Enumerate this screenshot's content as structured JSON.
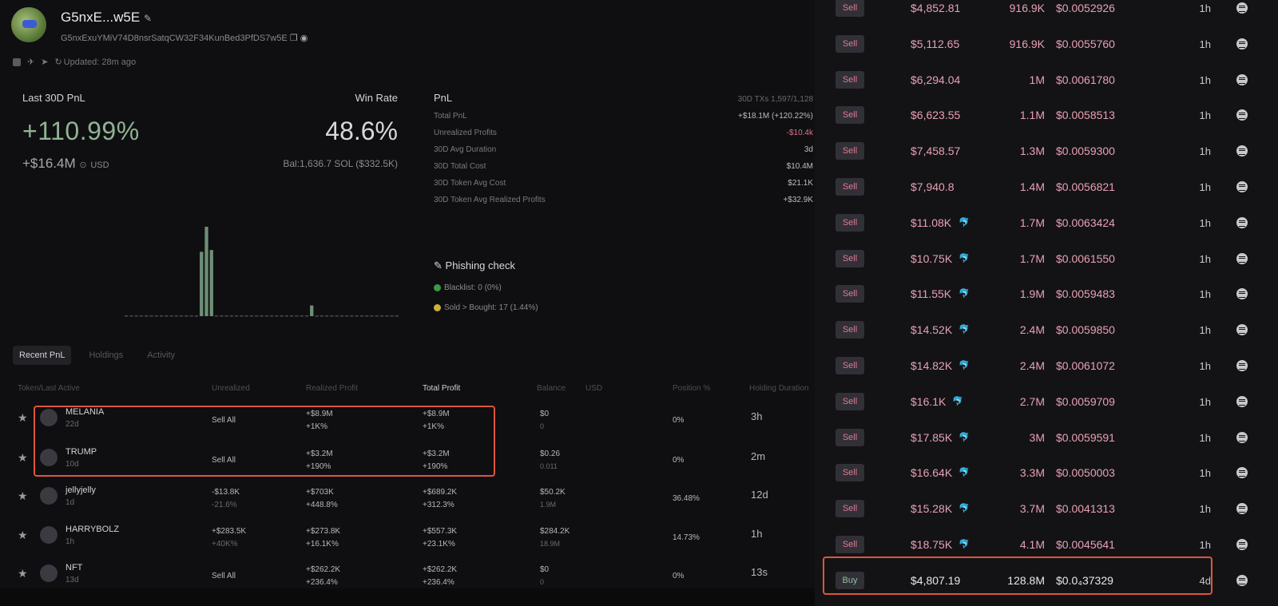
{
  "wallet": {
    "name": "G5nxE...w5E",
    "address": "G5nxExuYMiV74D8nsrSatqCW32F34KunBed3PfDS7w5E",
    "updated": "Updated: 28m ago"
  },
  "summary": {
    "pnl_label": "Last 30D PnL",
    "pnl_pct": "+110.99%",
    "pnl_usd": "+$16.4M",
    "usd_unit": "USD",
    "winrate_label": "Win Rate",
    "winrate": "48.6%",
    "balance": "Bal:1,636.7 SOL ($332.5K)"
  },
  "chart_data": {
    "type": "bar",
    "values": [
      0,
      0,
      0,
      0,
      0,
      0,
      0,
      0,
      0,
      0,
      0,
      0,
      0,
      0,
      0,
      72,
      100,
      74,
      0,
      0,
      0,
      0,
      0,
      0,
      0,
      0,
      0,
      0,
      0,
      0,
      0,
      0,
      0,
      0,
      0,
      0,
      0,
      12,
      0,
      0,
      0,
      0,
      0,
      0,
      0,
      0,
      0,
      0,
      0,
      0,
      0,
      0,
      0,
      0,
      0
    ]
  },
  "pnl": {
    "title": "PnL",
    "tx_label": "30D TXs",
    "tx_value": "1,597/1,128",
    "rows": [
      {
        "label": "Total PnL",
        "value": "+$18.1M (+120.22%)",
        "neg": false
      },
      {
        "label": "Unrealized Profits",
        "value": "-$10.4k",
        "neg": true
      },
      {
        "label": "30D Avg Duration",
        "value": "3d",
        "neg": false
      },
      {
        "label": "30D Total Cost",
        "value": "$10.4M",
        "neg": false
      },
      {
        "label": "30D Token Avg Cost",
        "value": "$21.1K",
        "neg": false
      },
      {
        "label": "30D Token Avg Realized Profits",
        "value": "+$32.9K",
        "neg": false
      }
    ]
  },
  "phishing": {
    "title": "Phishing check",
    "blacklist": "Blacklist: 0 (0%)",
    "sold_bought": "Sold > Bought: 17 (1.44%)"
  },
  "tabs": [
    "Recent PnL",
    "Holdings",
    "Activity"
  ],
  "table": {
    "headers": [
      "Token/Last Active",
      "Unrealized",
      "Realized Profit",
      "Total Profit",
      "Balance",
      "USD",
      "Position %",
      "Holding Duration"
    ],
    "rows": [
      {
        "name": "MELANIA",
        "age": "22d",
        "unreal1": "Sell All",
        "unreal2": "",
        "real1": "+$8.9M",
        "real2": "+1K%",
        "tot1": "+$8.9M",
        "tot2": "+1K%",
        "bal1": "$0",
        "bal2": "0",
        "pos": "0%",
        "hold": "3h"
      },
      {
        "name": "TRUMP",
        "age": "10d",
        "unreal1": "Sell All",
        "unreal2": "",
        "real1": "+$3.2M",
        "real2": "+190%",
        "tot1": "+$3.2M",
        "tot2": "+190%",
        "bal1": "$0.26",
        "bal2": "0.011",
        "pos": "0%",
        "hold": "2m"
      },
      {
        "name": "jellyjelly",
        "age": "1d",
        "unreal1": "-$13.8K",
        "unreal2": "-21.6%",
        "real1": "+$703K",
        "real2": "+448.8%",
        "tot1": "+$689.2K",
        "tot2": "+312.3%",
        "bal1": "$50.2K",
        "bal2": "1.9M",
        "pos": "36.48%",
        "hold": "12d"
      },
      {
        "name": "HARRYBOLZ",
        "age": "1h",
        "unreal1": "+$283.5K",
        "unreal2": "+40K%",
        "real1": "+$273.8K",
        "real2": "+16.1K%",
        "tot1": "+$557.3K",
        "tot2": "+23.1K%",
        "bal1": "$284.2K",
        "bal2": "18.9M",
        "pos": "14.73%",
        "hold": "1h"
      },
      {
        "name": "NFT",
        "age": "13d",
        "unreal1": "Sell All",
        "unreal2": "",
        "real1": "+$262.2K",
        "real2": "+236.4%",
        "tot1": "+$262.2K",
        "tot2": "+236.4%",
        "bal1": "$0",
        "bal2": "0",
        "pos": "0%",
        "hold": "13s"
      }
    ]
  },
  "activity": [
    {
      "type": "Sell",
      "amount": "$4,852.81",
      "dolphin": false,
      "qty": "916.9K",
      "price": "$0.0052926",
      "age": "1h"
    },
    {
      "type": "Sell",
      "amount": "$5,112.65",
      "dolphin": false,
      "qty": "916.9K",
      "price": "$0.0055760",
      "age": "1h"
    },
    {
      "type": "Sell",
      "amount": "$6,294.04",
      "dolphin": false,
      "qty": "1M",
      "price": "$0.0061780",
      "age": "1h"
    },
    {
      "type": "Sell",
      "amount": "$6,623.55",
      "dolphin": false,
      "qty": "1.1M",
      "price": "$0.0058513",
      "age": "1h"
    },
    {
      "type": "Sell",
      "amount": "$7,458.57",
      "dolphin": false,
      "qty": "1.3M",
      "price": "$0.0059300",
      "age": "1h"
    },
    {
      "type": "Sell",
      "amount": "$7,940.8",
      "dolphin": false,
      "qty": "1.4M",
      "price": "$0.0056821",
      "age": "1h"
    },
    {
      "type": "Sell",
      "amount": "$11.08K",
      "dolphin": true,
      "qty": "1.7M",
      "price": "$0.0063424",
      "age": "1h"
    },
    {
      "type": "Sell",
      "amount": "$10.75K",
      "dolphin": true,
      "qty": "1.7M",
      "price": "$0.0061550",
      "age": "1h"
    },
    {
      "type": "Sell",
      "amount": "$11.55K",
      "dolphin": true,
      "qty": "1.9M",
      "price": "$0.0059483",
      "age": "1h"
    },
    {
      "type": "Sell",
      "amount": "$14.52K",
      "dolphin": true,
      "qty": "2.4M",
      "price": "$0.0059850",
      "age": "1h"
    },
    {
      "type": "Sell",
      "amount": "$14.82K",
      "dolphin": true,
      "qty": "2.4M",
      "price": "$0.0061072",
      "age": "1h"
    },
    {
      "type": "Sell",
      "amount": "$16.1K",
      "dolphin": true,
      "qty": "2.7M",
      "price": "$0.0059709",
      "age": "1h"
    },
    {
      "type": "Sell",
      "amount": "$17.85K",
      "dolphin": true,
      "qty": "3M",
      "price": "$0.0059591",
      "age": "1h"
    },
    {
      "type": "Sell",
      "amount": "$16.64K",
      "dolphin": true,
      "qty": "3.3M",
      "price": "$0.0050003",
      "age": "1h"
    },
    {
      "type": "Sell",
      "amount": "$15.28K",
      "dolphin": true,
      "qty": "3.7M",
      "price": "$0.0041313",
      "age": "1h"
    },
    {
      "type": "Sell",
      "amount": "$18.75K",
      "dolphin": true,
      "qty": "4.1M",
      "price": "$0.0045641",
      "age": "1h"
    },
    {
      "type": "Buy",
      "amount": "$4,807.19",
      "dolphin": false,
      "qty": "128.8M",
      "price": "$0.0₄37329",
      "age": "4d"
    }
  ],
  "colors": {
    "accent_red_box": "#e0553b",
    "sell": "#e8a0b4",
    "buy": "#8fc39a",
    "positive": "#8fb394"
  }
}
